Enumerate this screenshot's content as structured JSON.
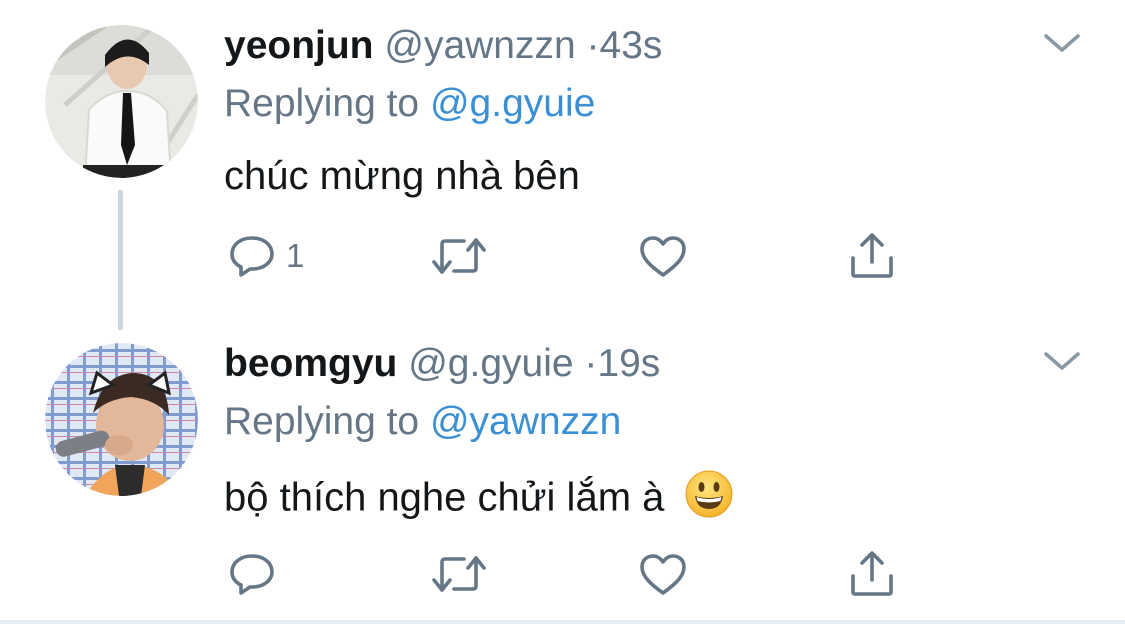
{
  "tweets": [
    {
      "display_name": "yeonjun",
      "handle": "@yawnzzn",
      "separator": "·",
      "time": "43s",
      "replying_prefix": "Replying to",
      "replying_to": "@g.gyuie",
      "text": "chúc mừng nhà bên",
      "reply_count": "1",
      "avatar_icon": "avatar-photo-boy-white-shirt"
    },
    {
      "display_name": "beomgyu",
      "handle": "@g.gyuie",
      "separator": "·",
      "time": "19s",
      "replying_prefix": "Replying to",
      "replying_to": "@yawnzzn",
      "text": "bộ thích nghe chửi lắm à",
      "reply_count": "",
      "emoji": "grinning-face-emoji",
      "avatar_icon": "avatar-photo-boy-cat-ears"
    }
  ],
  "colors": {
    "text_primary": "#14171a",
    "text_secondary": "#657786",
    "link": "#3b8fd4",
    "thread_line": "#cdd5dc",
    "icon": "#657786"
  },
  "icons": [
    "reply-icon",
    "retweet-icon",
    "like-icon",
    "share-icon",
    "chevron-down-icon"
  ]
}
